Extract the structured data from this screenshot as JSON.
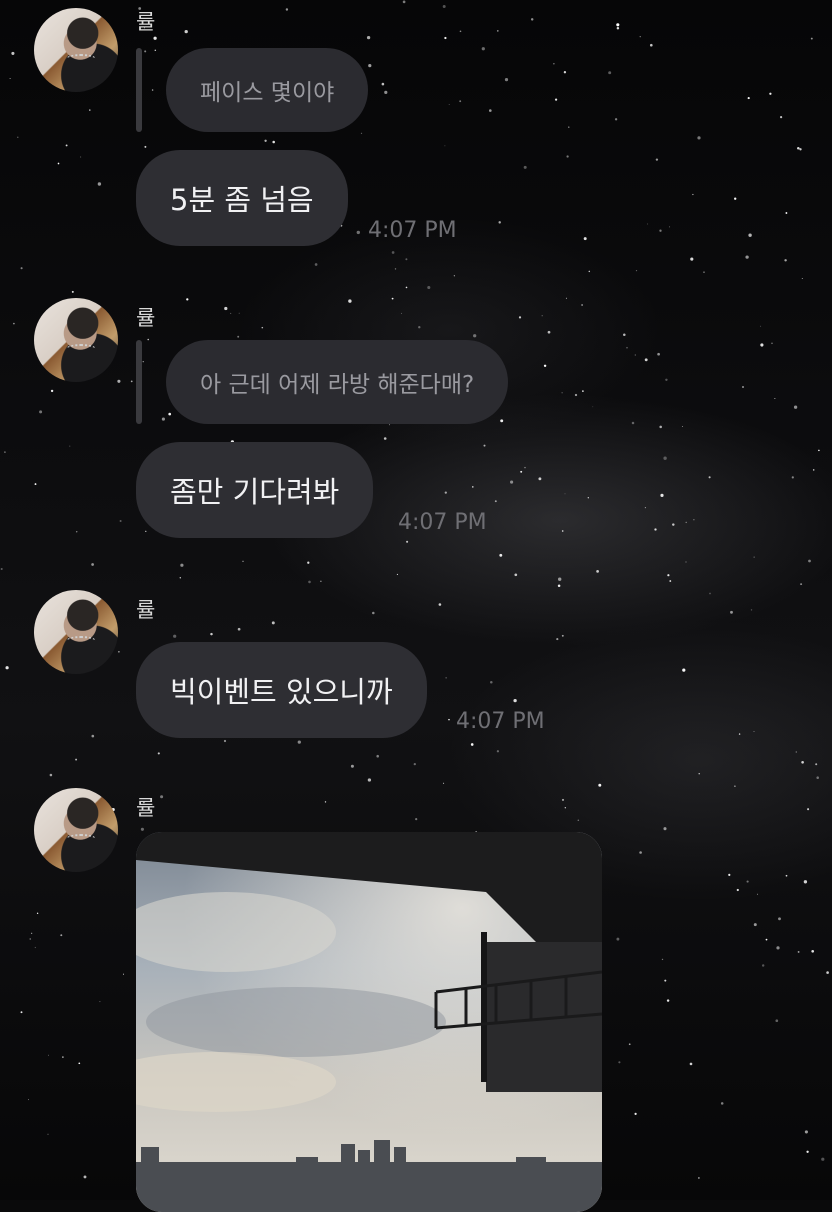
{
  "messages": [
    {
      "sender": "률",
      "reply_quote": "페이스 몇이야",
      "text": "5분 좀 넘음",
      "time": "4:07 PM"
    },
    {
      "sender": "률",
      "reply_quote": "아 근데 어제 라방 해준다매?",
      "text": "좀만 기다려봐",
      "time": "4:07 PM"
    },
    {
      "sender": "률",
      "text": "빅이벤트 있으니까",
      "time": "4:07 PM"
    },
    {
      "sender": "률",
      "attachment": "photo"
    }
  ],
  "colors": {
    "background": "#0a0a0b",
    "bubble": "#2e2e33",
    "reply_bubble": "#2b2b30",
    "reply_bar": "#3a3a3e",
    "time_text": "#6f6f74"
  }
}
